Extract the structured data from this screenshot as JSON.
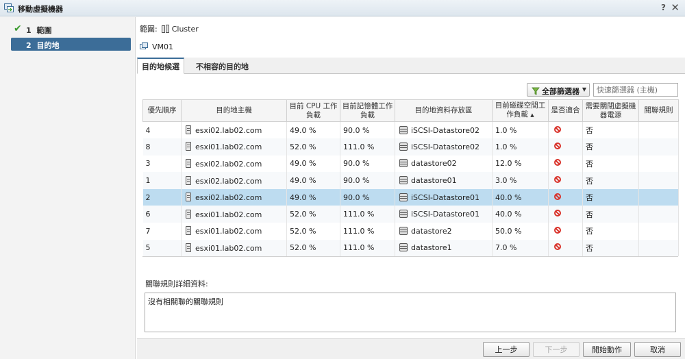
{
  "window": {
    "title": "移動虛擬機器",
    "help": "?",
    "close": "✕"
  },
  "nav": {
    "steps": [
      {
        "number": "1",
        "label": "範圍",
        "status": "completed"
      },
      {
        "number": "2",
        "label": "目的地",
        "status": "active"
      }
    ]
  },
  "scope": {
    "label": "範圍:",
    "value": "Cluster"
  },
  "vm": {
    "name": "VM01"
  },
  "tabs": [
    {
      "label": "目的地候選",
      "active": true
    },
    {
      "label": "不相容的目的地",
      "active": false
    }
  ],
  "toolbar": {
    "filter_label": "全部篩選器",
    "quick_filter_placeholder": "快速篩選器 (主機)"
  },
  "table": {
    "columns": [
      "優先順序",
      "目的地主機",
      "目前 CPU 工作負載",
      "目前記憶體工作負載",
      "目的地資料存放區",
      "目前磁碟空間工作負載",
      "是否適合",
      "需要關閉虛擬機器電源",
      "關聯規則"
    ],
    "rows": [
      {
        "priority": "4",
        "host": "esxi02.lab02.com",
        "cpu": "49.0 %",
        "mem": "90.0 %",
        "datastore": "iSCSI-Datastore02",
        "disk": "1.0 %",
        "poweroff": "否",
        "selected": false
      },
      {
        "priority": "8",
        "host": "esxi01.lab02.com",
        "cpu": "52.0 %",
        "mem": "111.0 %",
        "datastore": "iSCSI-Datastore02",
        "disk": "1.0 %",
        "poweroff": "否",
        "selected": false
      },
      {
        "priority": "3",
        "host": "esxi02.lab02.com",
        "cpu": "49.0 %",
        "mem": "90.0 %",
        "datastore": "datastore02",
        "disk": "12.0 %",
        "poweroff": "否",
        "selected": false
      },
      {
        "priority": "1",
        "host": "esxi02.lab02.com",
        "cpu": "49.0 %",
        "mem": "90.0 %",
        "datastore": "datastore01",
        "disk": "3.0 %",
        "poweroff": "否",
        "selected": false
      },
      {
        "priority": "2",
        "host": "esxi02.lab02.com",
        "cpu": "49.0 %",
        "mem": "90.0 %",
        "datastore": "iSCSI-Datastore01",
        "disk": "40.0 %",
        "poweroff": "否",
        "selected": true
      },
      {
        "priority": "6",
        "host": "esxi01.lab02.com",
        "cpu": "52.0 %",
        "mem": "111.0 %",
        "datastore": "iSCSI-Datastore01",
        "disk": "40.0 %",
        "poweroff": "否",
        "selected": false
      },
      {
        "priority": "7",
        "host": "esxi01.lab02.com",
        "cpu": "52.0 %",
        "mem": "111.0 %",
        "datastore": "datastore2",
        "disk": "50.0 %",
        "poweroff": "否",
        "selected": false
      },
      {
        "priority": "5",
        "host": "esxi01.lab02.com",
        "cpu": "52.0 %",
        "mem": "111.0 %",
        "datastore": "datastore1",
        "disk": "7.0 %",
        "poweroff": "否",
        "selected": false
      }
    ]
  },
  "details": {
    "label": "關聯規則詳細資料:",
    "text": "沒有相關聯的關聯規則"
  },
  "footer": {
    "back": "上一步",
    "next": "下一步",
    "finish": "開始動作",
    "cancel": "取消"
  },
  "colors": {
    "accent": "#3c6d98",
    "selected_row": "#bddcf0",
    "check": "#3a9a2e",
    "not_suitable": "#d9322a"
  }
}
